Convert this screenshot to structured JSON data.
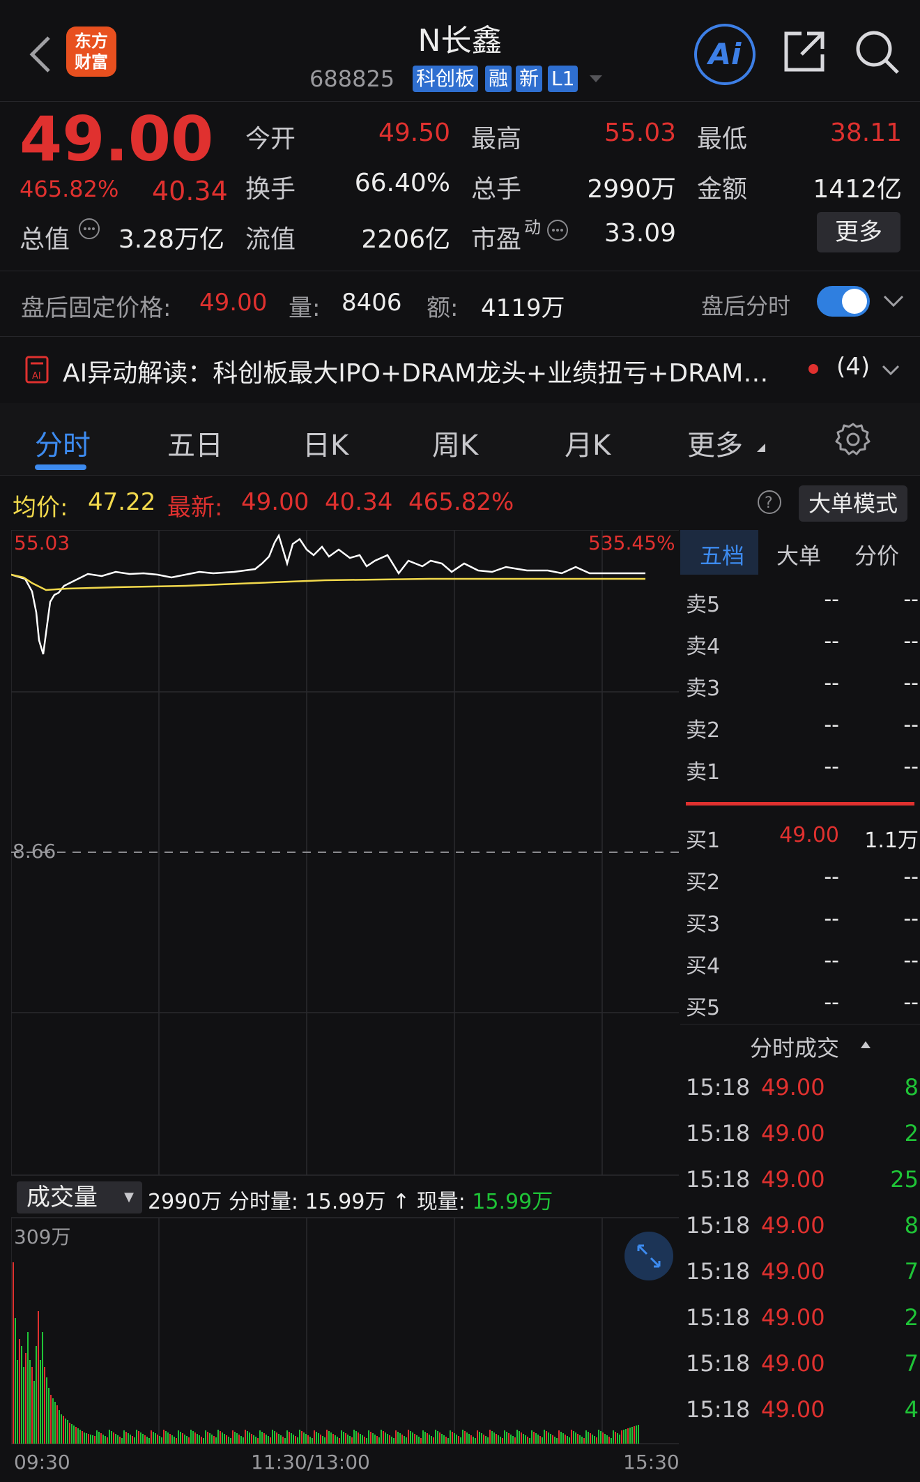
{
  "header": {
    "logo_line1": "东方",
    "logo_line2": "财富",
    "title": "N长鑫",
    "code": "688825",
    "tags": [
      "科创板",
      "融",
      "新",
      "L1"
    ],
    "ai_label": "Ai"
  },
  "quote": {
    "price": "49.00",
    "change_pct": "465.82%",
    "change": "40.34",
    "open_label": "今开",
    "open": "49.50",
    "high_label": "最高",
    "high": "55.03",
    "low_label": "最低",
    "low": "38.11",
    "turnover_label": "换手",
    "turnover": "66.40%",
    "volume_label": "总手",
    "volume": "2990万",
    "amount_label": "金额",
    "amount": "1412亿",
    "mktcap_label": "总值",
    "mktcap": "3.28万亿",
    "float_label": "流值",
    "float": "2206亿",
    "pe_label": "市盈",
    "pe_sup": "动",
    "pe": "33.09",
    "more_label": "更多"
  },
  "after_hours": {
    "label": "盘后固定价格:",
    "price": "49.00",
    "vol_label": "量:",
    "vol": "8406",
    "amt_label": "额:",
    "amt": "4119万",
    "toggle_label": "盘后分时",
    "toggle_on": true
  },
  "ai_row": {
    "text": "AI异动解读：科创板最大IPO+DRAM龙头+业绩扭亏+DRAM…",
    "count": "(4)"
  },
  "tabs": [
    "分时",
    "五日",
    "日K",
    "周K",
    "月K",
    "更多"
  ],
  "info_line": {
    "avg_label": "均价:",
    "avg": "47.22",
    "latest_label": "最新:",
    "latest": "49.00",
    "chg": "40.34",
    "pct": "465.82%",
    "big_mode": "大单模式"
  },
  "chart_labels": {
    "top_price": "55.03",
    "top_pct": "535.45%",
    "prev_close": "8.66",
    "vol_max": "309万",
    "t_start": "09:30",
    "t_mid": "11:30/13:00",
    "t_end": "15:30"
  },
  "volume_bar": {
    "select": "成交量",
    "total": "2990万",
    "min_label": "分时量:",
    "min_vol": "15.99万",
    "cur_label": "现量:",
    "cur_vol": "15.99万"
  },
  "order_book": {
    "tabs": [
      "五档",
      "大单",
      "分价"
    ],
    "asks": [
      {
        "label": "卖5",
        "price": "--",
        "vol": "--"
      },
      {
        "label": "卖4",
        "price": "--",
        "vol": "--"
      },
      {
        "label": "卖3",
        "price": "--",
        "vol": "--"
      },
      {
        "label": "卖2",
        "price": "--",
        "vol": "--"
      },
      {
        "label": "卖1",
        "price": "--",
        "vol": "--"
      }
    ],
    "bids": [
      {
        "label": "买1",
        "price": "49.00",
        "vol": "1.1万"
      },
      {
        "label": "买2",
        "price": "--",
        "vol": "--"
      },
      {
        "label": "买3",
        "price": "--",
        "vol": "--"
      },
      {
        "label": "买4",
        "price": "--",
        "vol": "--"
      },
      {
        "label": "买5",
        "price": "--",
        "vol": "--"
      }
    ],
    "ticks_title": "分时成交",
    "ticks": [
      {
        "time": "15:18",
        "price": "49.00",
        "vol": "8"
      },
      {
        "time": "15:18",
        "price": "49.00",
        "vol": "2"
      },
      {
        "time": "15:18",
        "price": "49.00",
        "vol": "25"
      },
      {
        "time": "15:18",
        "price": "49.00",
        "vol": "8"
      },
      {
        "time": "15:18",
        "price": "49.00",
        "vol": "7"
      },
      {
        "time": "15:18",
        "price": "49.00",
        "vol": "2"
      },
      {
        "time": "15:18",
        "price": "49.00",
        "vol": "7"
      },
      {
        "time": "15:18",
        "price": "49.00",
        "vol": "4"
      }
    ]
  },
  "colors": {
    "up": "#e0312f",
    "down": "#1fc437",
    "accent": "#3d8bf0",
    "avg_line": "#f2d94c",
    "price_line": "#ffffff"
  }
}
